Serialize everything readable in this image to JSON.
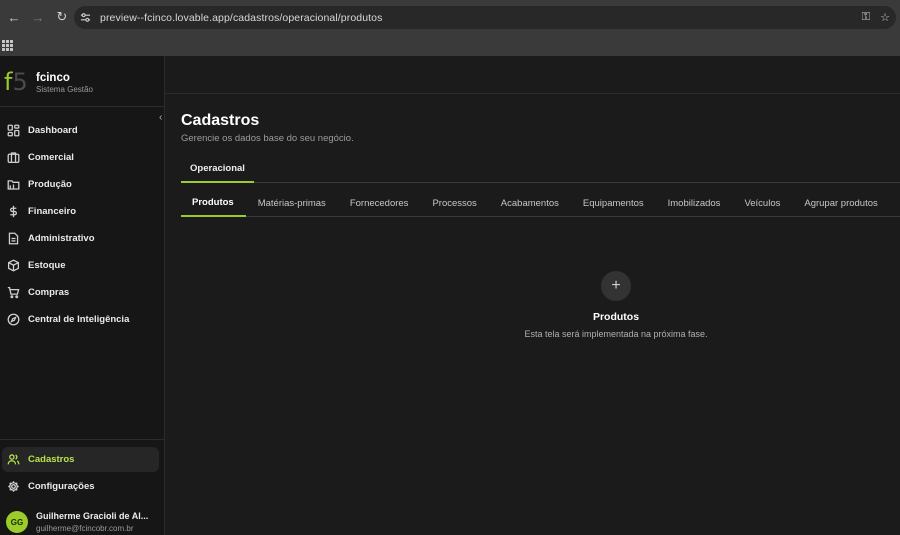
{
  "browser": {
    "url": "preview--fcinco.lovable.app/cadastros/operacional/produtos",
    "back_glyph": "←",
    "forward_glyph": "→",
    "reload_glyph": "↻",
    "key_glyph": "⚿",
    "star_glyph": "☆"
  },
  "brand": {
    "logo_f": "f",
    "logo_5": "5",
    "name": "fcinco",
    "subtitle": "Sistema Gestão",
    "accent": "#9ccc2a"
  },
  "sidebar": {
    "collapse_glyph": "‹",
    "items": [
      {
        "label": "Dashboard",
        "icon": "dashboard-icon"
      },
      {
        "label": "Comercial",
        "icon": "briefcase-icon"
      },
      {
        "label": "Produção",
        "icon": "folder-icon"
      },
      {
        "label": "Financeiro",
        "icon": "dollar-icon"
      },
      {
        "label": "Administrativo",
        "icon": "document-icon"
      },
      {
        "label": "Estoque",
        "icon": "box-icon"
      },
      {
        "label": "Compras",
        "icon": "cart-icon"
      },
      {
        "label": "Central de Inteligência",
        "icon": "compass-icon"
      }
    ],
    "bottom_items": [
      {
        "label": "Cadastros",
        "icon": "users-icon",
        "active": true
      },
      {
        "label": "Configurações",
        "icon": "gear-icon"
      }
    ]
  },
  "user": {
    "initials": "GG",
    "name": "Guilherme Gracioli de Al...",
    "email": "guilherme@fcincobr.com.br"
  },
  "page": {
    "title": "Cadastros",
    "subtitle": "Gerencie os dados base do seu negócio."
  },
  "primary_tabs": [
    {
      "label": "Operacional",
      "active": true
    }
  ],
  "secondary_tabs": [
    {
      "label": "Produtos",
      "active": true
    },
    {
      "label": "Matérias-primas"
    },
    {
      "label": "Fornecedores"
    },
    {
      "label": "Processos"
    },
    {
      "label": "Acabamentos"
    },
    {
      "label": "Equipamentos"
    },
    {
      "label": "Imobilizados"
    },
    {
      "label": "Veículos"
    },
    {
      "label": "Agrupar produtos"
    }
  ],
  "empty_state": {
    "icon_glyph": "+",
    "title": "Produtos",
    "description": "Esta tela será implementada na próxima fase."
  }
}
